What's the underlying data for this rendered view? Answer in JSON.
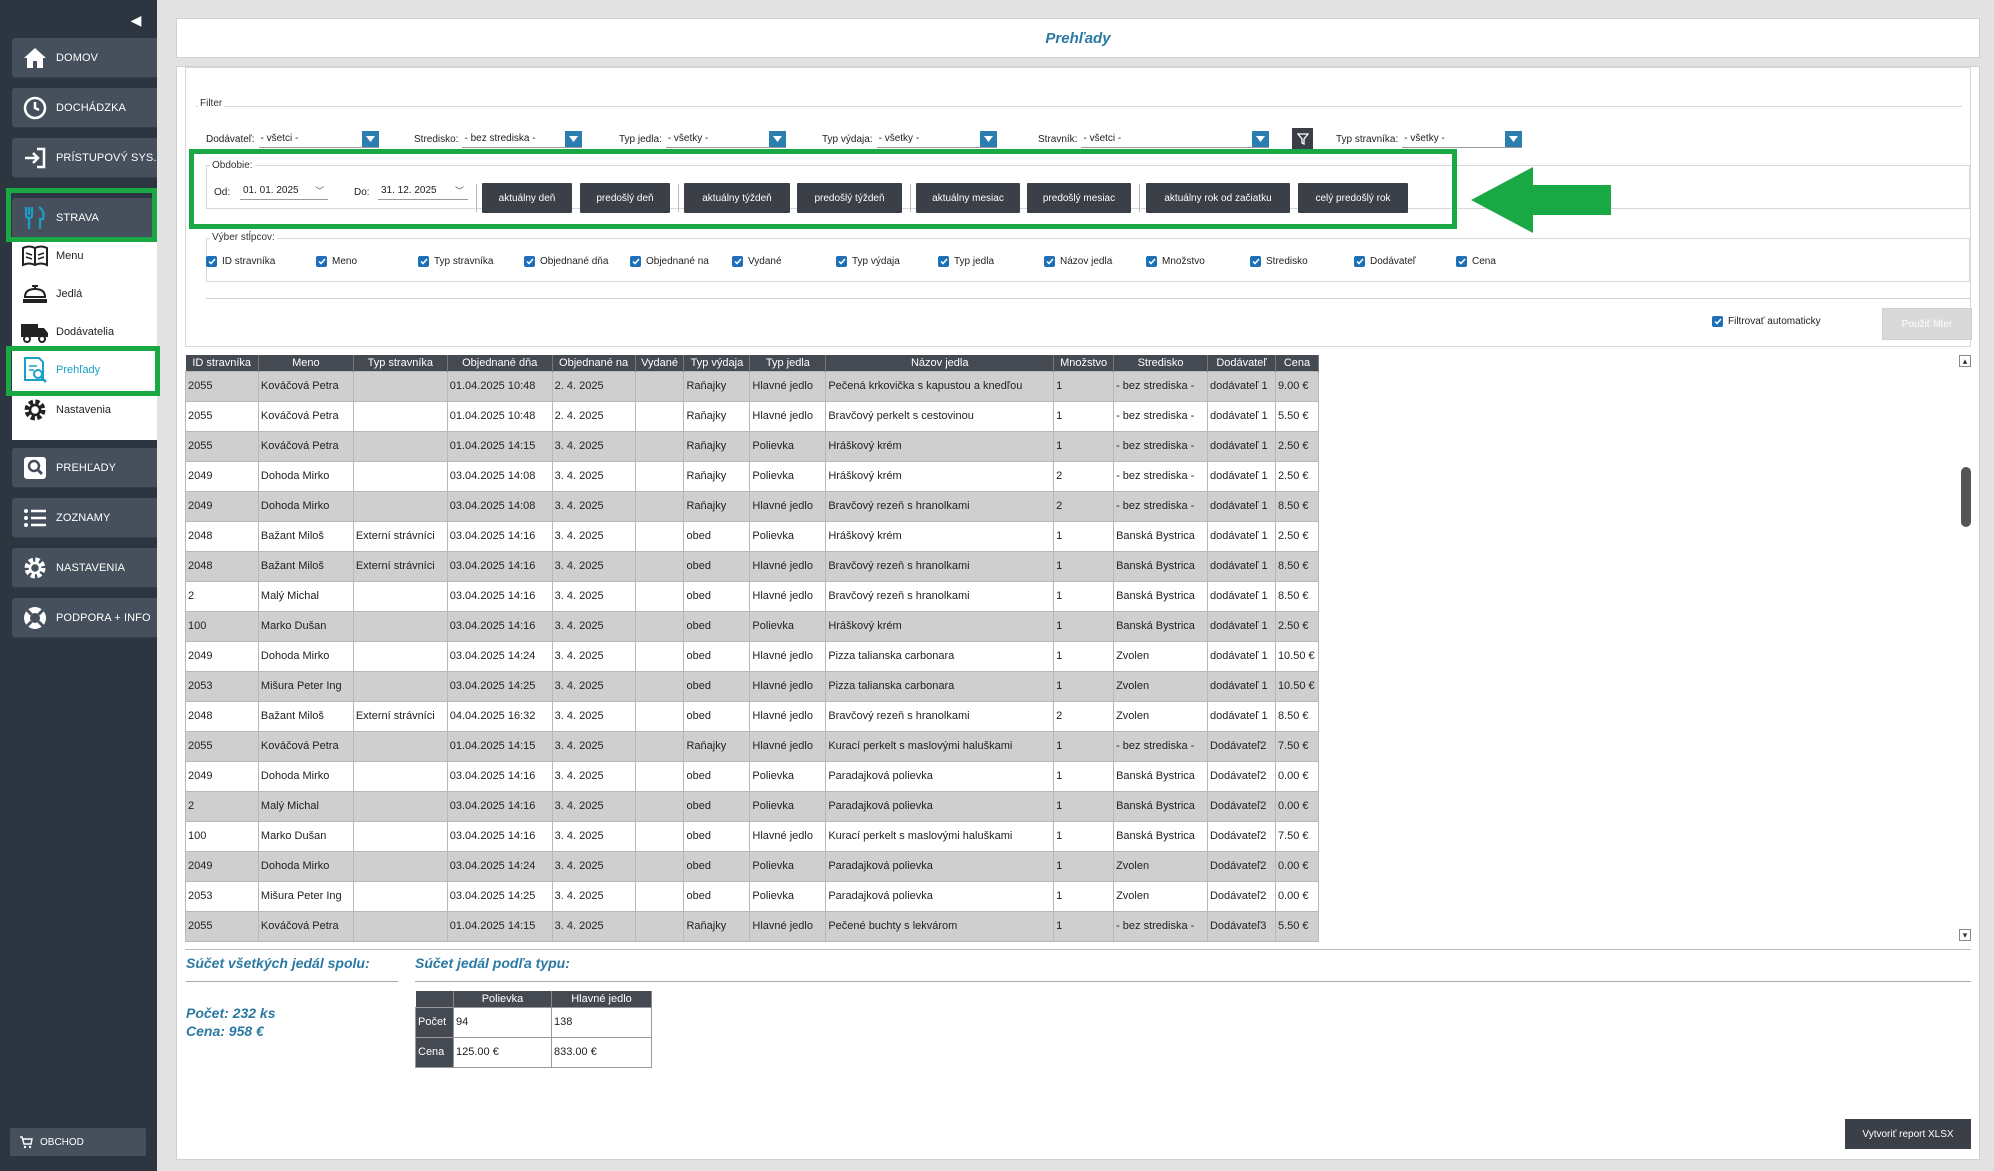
{
  "sidebar": {
    "main_items": [
      {
        "label": "DOMOV",
        "icon": "home-icon"
      },
      {
        "label": "DOCHÁDZKA",
        "icon": "clock-icon"
      },
      {
        "label": "PRÍSTUPOVÝ SYS.",
        "icon": "login-icon"
      },
      {
        "label": "STRAVA",
        "icon": "fork-knife-icon"
      }
    ],
    "sub_items": [
      {
        "label": "Menu",
        "icon": "menu-book-icon"
      },
      {
        "label": "Jedlá",
        "icon": "food-tray-icon"
      },
      {
        "label": "Dodávatelia",
        "icon": "truck-icon"
      },
      {
        "label": "Prehľady",
        "icon": "report-search-icon"
      },
      {
        "label": "Nastavenia",
        "icon": "gear-icon"
      }
    ],
    "bottom_items": [
      {
        "label": "PREHĽADY",
        "icon": "search-icon"
      },
      {
        "label": "ZOZNAMY",
        "icon": "list-icon"
      },
      {
        "label": "NASTAVENIA",
        "icon": "gear-icon"
      },
      {
        "label": "PODPORA + INFO",
        "icon": "lifebuoy-icon"
      }
    ],
    "shop_label": "OBCHOD"
  },
  "page": {
    "title": "Prehľady"
  },
  "filter": {
    "legend": "Filter",
    "fields": [
      {
        "label": "Dodávateľ:",
        "value": "- všetci -"
      },
      {
        "label": "Stredisko:",
        "value": "- bez strediska -"
      },
      {
        "label": "Typ jedla:",
        "value": "- všetky -"
      },
      {
        "label": "Typ výdaja:",
        "value": "- všetky -"
      },
      {
        "label": "Stravník:",
        "value": "- všetci -"
      },
      {
        "label": "Typ stravníka:",
        "value": "- všetky -"
      }
    ],
    "period": {
      "legend": "Obdobie:",
      "from_label": "Od:",
      "from_value": "01. 01. 2025",
      "to_label": "Do:",
      "to_value": "31. 12. 2025",
      "buttons": [
        "aktuálny deň",
        "predošlý deň",
        "aktuálny týždeň",
        "predošlý týždeň",
        "aktuálny mesiac",
        "predošlý mesiac",
        "aktuálny rok od začiatku",
        "celý predošlý rok"
      ]
    },
    "columns_legend": "Výber stĺpcov:",
    "columns": [
      "ID stravníka",
      "Meno",
      "Typ stravníka",
      "Objednané dňa",
      "Objednané na",
      "Vydané",
      "Typ výdaja",
      "Typ jedla",
      "Názov jedla",
      "Množstvo",
      "Stredisko",
      "Dodávateľ",
      "Cena"
    ],
    "auto_filter_label": "Filtrovať automaticky",
    "apply_label": "Použiť filter"
  },
  "table": {
    "headers": [
      "ID stravníka",
      "Meno",
      "Typ stravníka",
      "Objednané dňa",
      "Objednané na",
      "Vydané",
      "Typ výdaja",
      "Typ jedla",
      "Názov jedla",
      "Množstvo",
      "Stredisko",
      "Dodávateľ",
      "Cena"
    ],
    "rows": [
      [
        "2055",
        "Kováčová Petra",
        "",
        "01.04.2025 10:48",
        "2. 4. 2025",
        "",
        "Raňajky",
        "Hlavné jedlo",
        "Pečená krkovička s kapustou a knedľou",
        "1",
        "- bez strediska -",
        "dodávateľ 1",
        "9.00 €"
      ],
      [
        "2055",
        "Kováčová Petra",
        "",
        "01.04.2025 10:48",
        "2. 4. 2025",
        "",
        "Raňajky",
        "Hlavné jedlo",
        "Bravčový perkelt s cestovinou",
        "1",
        "- bez strediska -",
        "dodávateľ 1",
        "5.50 €"
      ],
      [
        "2055",
        "Kováčová Petra",
        "",
        "01.04.2025 14:15",
        "3. 4. 2025",
        "",
        "Raňajky",
        "Polievka",
        "Hráškový krém",
        "1",
        "- bez strediska -",
        "dodávateľ 1",
        "2.50 €"
      ],
      [
        "2049",
        "Dohoda Mirko",
        "",
        "03.04.2025 14:08",
        "3. 4. 2025",
        "",
        "Raňajky",
        "Polievka",
        "Hráškový krém",
        "2",
        "- bez strediska -",
        "dodávateľ 1",
        "2.50 €"
      ],
      [
        "2049",
        "Dohoda Mirko",
        "",
        "03.04.2025 14:08",
        "3. 4. 2025",
        "",
        "Raňajky",
        "Hlavné jedlo",
        "Bravčový rezeň s hranolkami",
        "2",
        "- bez strediska -",
        "dodávateľ 1",
        "8.50 €"
      ],
      [
        "2048",
        "Bažant Miloš",
        "Externí strávníci",
        "03.04.2025 14:16",
        "3. 4. 2025",
        "",
        "obed",
        "Polievka",
        "Hráškový krém",
        "1",
        "Banská Bystrica",
        "dodávateľ 1",
        "2.50 €"
      ],
      [
        "2048",
        "Bažant Miloš",
        "Externí strávníci",
        "03.04.2025 14:16",
        "3. 4. 2025",
        "",
        "obed",
        "Hlavné jedlo",
        "Bravčový rezeň s hranolkami",
        "1",
        "Banská Bystrica",
        "dodávateľ 1",
        "8.50 €"
      ],
      [
        "2",
        "Malý Michal",
        "",
        "03.04.2025 14:16",
        "3. 4. 2025",
        "",
        "obed",
        "Hlavné jedlo",
        "Bravčový rezeň s hranolkami",
        "1",
        "Banská Bystrica",
        "dodávateľ 1",
        "8.50 €"
      ],
      [
        "100",
        "Marko Dušan",
        "",
        "03.04.2025 14:16",
        "3. 4. 2025",
        "",
        "obed",
        "Polievka",
        "Hráškový krém",
        "1",
        "Banská Bystrica",
        "dodávateľ 1",
        "2.50 €"
      ],
      [
        "2049",
        "Dohoda Mirko",
        "",
        "03.04.2025 14:24",
        "3. 4. 2025",
        "",
        "obed",
        "Hlavné jedlo",
        "Pizza talianska carbonara",
        "1",
        "Zvolen",
        "dodávateľ 1",
        "10.50 €"
      ],
      [
        "2053",
        "Mišura Peter Ing",
        "",
        "03.04.2025 14:25",
        "3. 4. 2025",
        "",
        "obed",
        "Hlavné jedlo",
        "Pizza talianska carbonara",
        "1",
        "Zvolen",
        "dodávateľ 1",
        "10.50 €"
      ],
      [
        "2048",
        "Bažant Miloš",
        "Externí strávníci",
        "04.04.2025 16:32",
        "3. 4. 2025",
        "",
        "obed",
        "Hlavné jedlo",
        "Bravčový rezeň s hranolkami",
        "2",
        "Zvolen",
        "dodávateľ 1",
        "8.50 €"
      ],
      [
        "2055",
        "Kováčová Petra",
        "",
        "01.04.2025 14:15",
        "3. 4. 2025",
        "",
        "Raňajky",
        "Hlavné jedlo",
        "Kurací perkelt s maslovými haluškami",
        "1",
        "- bez strediska -",
        "Dodávateľ2",
        "7.50 €"
      ],
      [
        "2049",
        "Dohoda Mirko",
        "",
        "03.04.2025 14:16",
        "3. 4. 2025",
        "",
        "obed",
        "Polievka",
        "Paradajková polievka",
        "1",
        "Banská Bystrica",
        "Dodávateľ2",
        "0.00 €"
      ],
      [
        "2",
        "Malý Michal",
        "",
        "03.04.2025 14:16",
        "3. 4. 2025",
        "",
        "obed",
        "Polievka",
        "Paradajková polievka",
        "1",
        "Banská Bystrica",
        "Dodávateľ2",
        "0.00 €"
      ],
      [
        "100",
        "Marko Dušan",
        "",
        "03.04.2025 14:16",
        "3. 4. 2025",
        "",
        "obed",
        "Hlavné jedlo",
        "Kurací perkelt s maslovými haluškami",
        "1",
        "Banská Bystrica",
        "Dodávateľ2",
        "7.50 €"
      ],
      [
        "2049",
        "Dohoda Mirko",
        "",
        "03.04.2025 14:24",
        "3. 4. 2025",
        "",
        "obed",
        "Polievka",
        "Paradajková polievka",
        "1",
        "Zvolen",
        "Dodávateľ2",
        "0.00 €"
      ],
      [
        "2053",
        "Mišura Peter Ing",
        "",
        "03.04.2025 14:25",
        "3. 4. 2025",
        "",
        "obed",
        "Polievka",
        "Paradajková polievka",
        "1",
        "Zvolen",
        "Dodávateľ2",
        "0.00 €"
      ],
      [
        "2055",
        "Kováčová Petra",
        "",
        "01.04.2025 14:15",
        "3. 4. 2025",
        "",
        "Raňajky",
        "Hlavné jedlo",
        "Pečené buchty s lekvárom",
        "1",
        "- bez strediska -",
        "Dodávateľ3",
        "5.50 €"
      ]
    ]
  },
  "summary": {
    "total_title": "Súčet všetkých jedál spolu:",
    "count_line": "Počet: 232 ks",
    "price_line": "Cena: 958 €",
    "by_type_title": "Súčet jedál podľa typu:",
    "type_headers": [
      "Polievka",
      "Hlavné jedlo"
    ],
    "type_rows": [
      {
        "label": "Počet",
        "values": [
          "94",
          "138"
        ]
      },
      {
        "label": "Cena",
        "values": [
          "125.00 €",
          "833.00 €"
        ]
      }
    ]
  },
  "export_label": "Vytvoriť report XLSX",
  "colors": {
    "sidebar": "#2d3540",
    "accent": "#2b79a3",
    "highlight": "#1aa844",
    "button_dark": "#3b3f47"
  }
}
